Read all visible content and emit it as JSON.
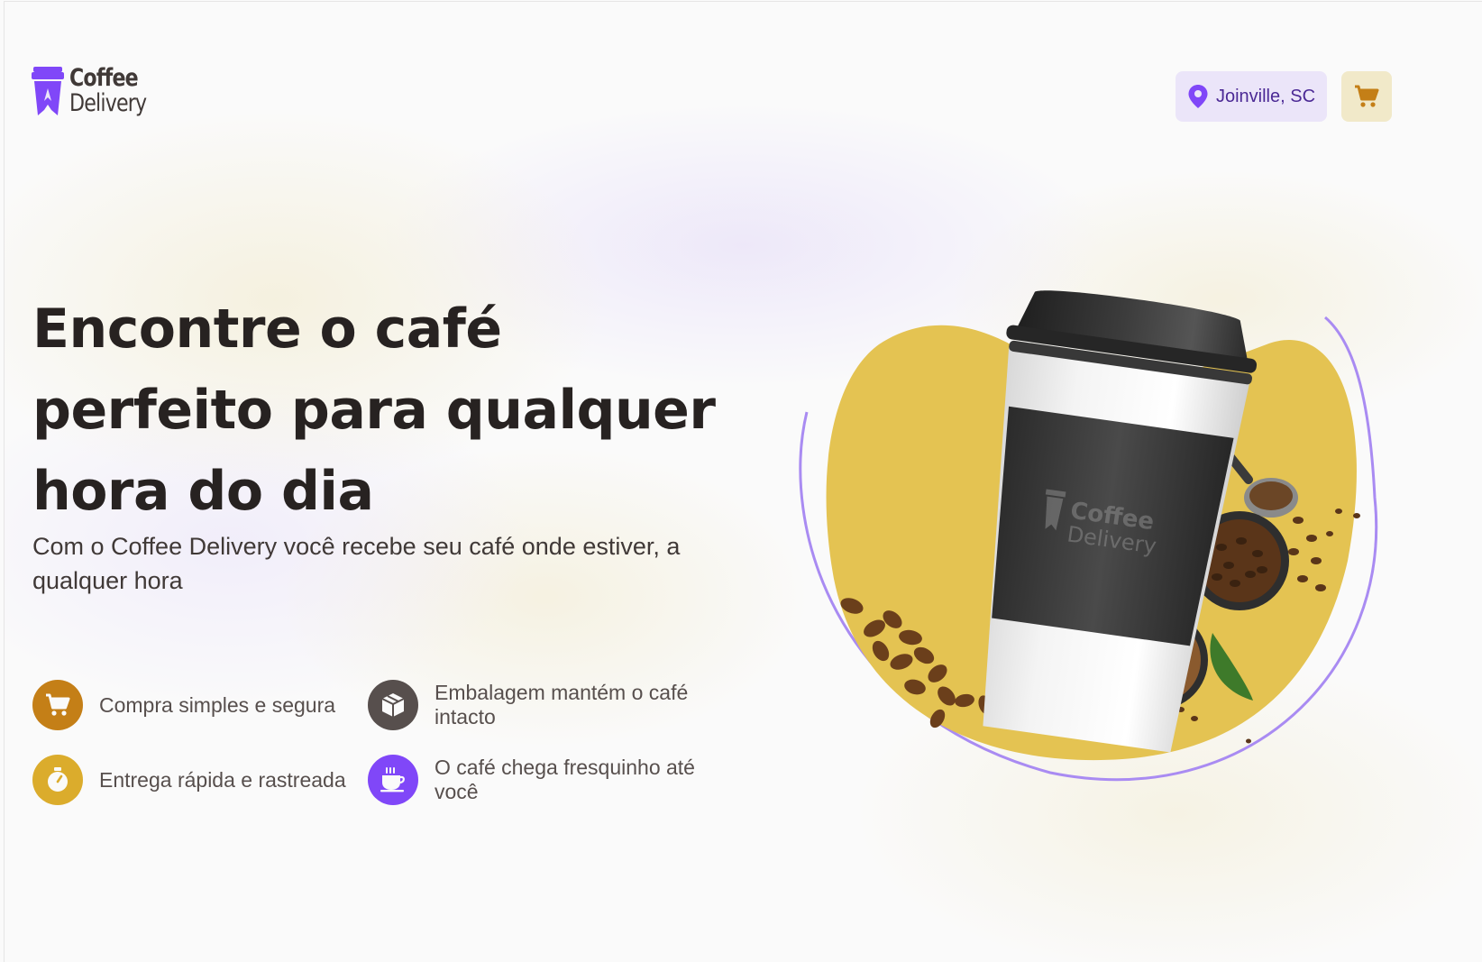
{
  "header": {
    "logo": {
      "line1": "Coffee",
      "line2": "Delivery"
    },
    "location": {
      "label": "Joinville, SC",
      "icon": "map-pin-icon"
    },
    "cart": {
      "icon": "shopping-cart-icon"
    }
  },
  "hero": {
    "title": "Encontre o café perfeito para qualquer hora do dia",
    "subtitle": "Com o Coffee Delivery você recebe seu café onde estiver, a qualquer hora",
    "features": [
      {
        "label": "Compra simples e segura",
        "icon": "shopping-cart-icon",
        "color": "#c47f17"
      },
      {
        "label": "Embalagem mantém o café intacto",
        "icon": "package-icon",
        "color": "#574f4d"
      },
      {
        "label": "Entrega rápida e rastreada",
        "icon": "timer-icon",
        "color": "#dbac2c"
      },
      {
        "label": "O café chega fresquinho até você",
        "icon": "coffee-icon",
        "color": "#8047f8"
      }
    ],
    "image": {
      "cup_logo_line1": "Coffee",
      "cup_logo_line2": "Delivery"
    }
  },
  "colors": {
    "purple": "#8047f8",
    "purple_dark": "#4b2995",
    "purple_light": "#ebe5f9",
    "yellow": "#dbac2c",
    "yellow_dark": "#c47f17",
    "yellow_light": "#f1e9c9",
    "title": "#272221",
    "text": "#574f4d"
  }
}
